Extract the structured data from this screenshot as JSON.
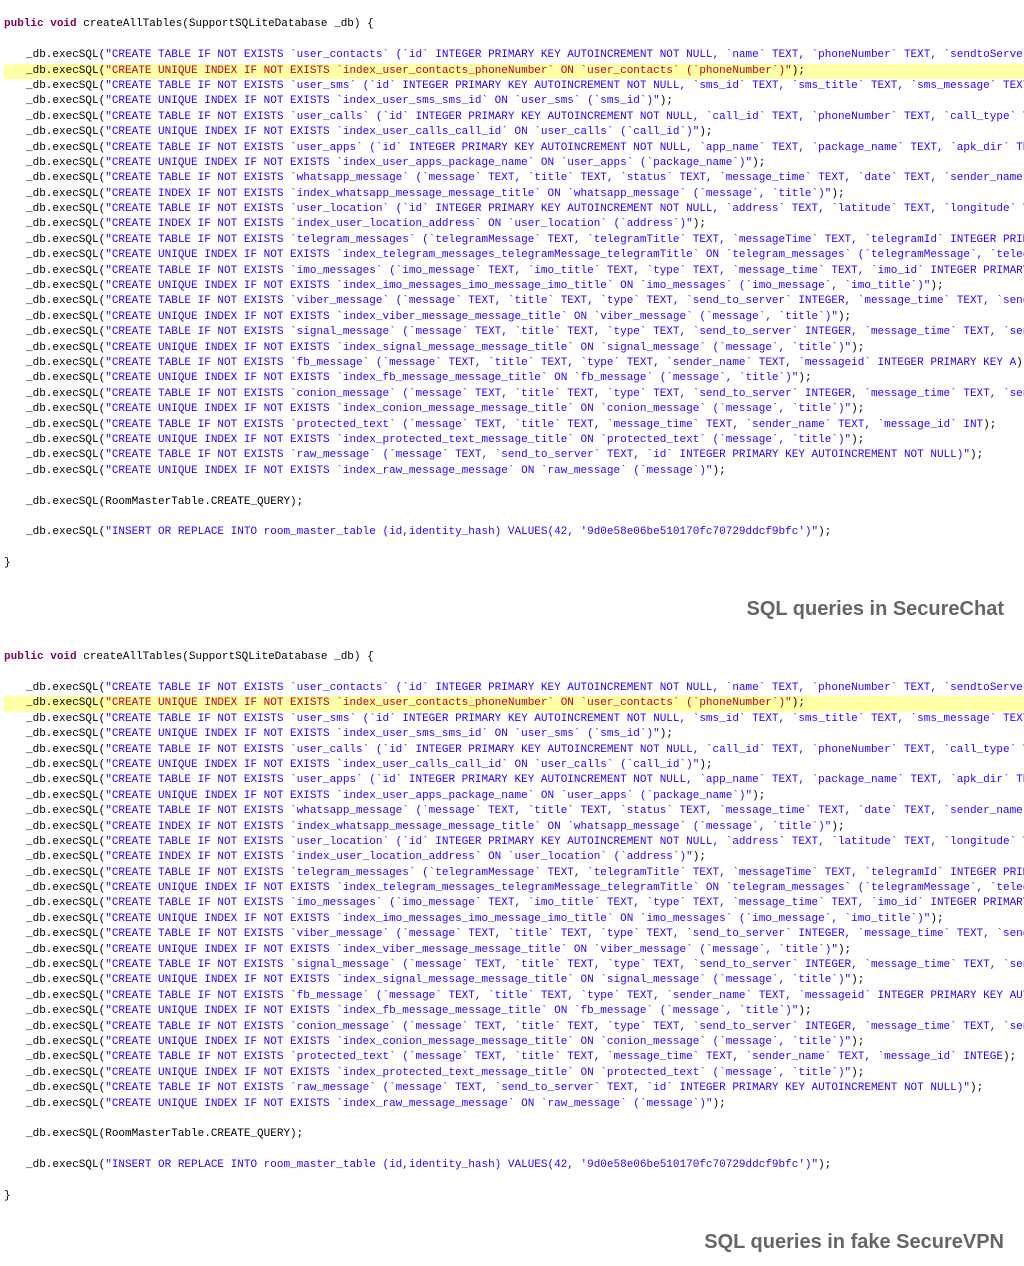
{
  "caption_top": "SQL queries in SecureChat",
  "caption_bottom": "SQL queries in fake SecureVPN",
  "sig_kw1": "public",
  "sig_kw2": "void",
  "sig_method": "createAllTables",
  "sig_param": "(SupportSQLiteDatabase _db) {",
  "call_prefix": "_db.execSQL(",
  "call_suffix": ");",
  "hl_a": "\"CREATE UNIQUE INDEX IF NOT EXISTS `",
  "hl_b": "index_user_contacts_phoneNumber` ON `user_contacts` (`phoneNumber`)\"",
  "create_query": "_db.execSQL(RoomMasterTable.CREATE_QUERY);",
  "top_lines": [
    "\"CREATE TABLE IF NOT EXISTS `user_contacts` (`id` INTEGER PRIMARY KEY AUTOINCREMENT NOT NULL, `name` TEXT, `phoneNumber` TEXT, `sendtoServer` INTE",
    "",
    "\"CREATE TABLE IF NOT EXISTS `user_sms` (`id` INTEGER PRIMARY KEY AUTOINCREMENT NOT NULL, `sms_id` TEXT, `sms_title` TEXT, `sms_message` TEXT, `sms",
    "\"CREATE UNIQUE INDEX IF NOT EXISTS `index_user_sms_sms_id` ON `user_sms` (`sms_id`)\"",
    "\"CREATE TABLE IF NOT EXISTS `user_calls` (`id` INTEGER PRIMARY KEY AUTOINCREMENT NOT NULL, `call_id` TEXT, `phoneNumber` TEXT, `call_type` TEXT, `",
    "\"CREATE UNIQUE INDEX IF NOT EXISTS `index_user_calls_call_id` ON `user_calls` (`call_id`)\"",
    "\"CREATE TABLE IF NOT EXISTS `user_apps` (`id` INTEGER PRIMARY KEY AUTOINCREMENT NOT NULL, `app_name` TEXT, `package_name` TEXT, `apk_dir` TEXT, `i",
    "\"CREATE UNIQUE INDEX IF NOT EXISTS `index_user_apps_package_name` ON `user_apps` (`package_name`)\"",
    "\"CREATE TABLE IF NOT EXISTS `whatsapp_message` (`message` TEXT, `title` TEXT, `status` TEXT, `message_time` TEXT, `date` TEXT, `sender_name` TEXT",
    "\"CREATE INDEX IF NOT EXISTS `index_whatsapp_message_message_title` ON `whatsapp_message` (`message`, `title`)\"",
    "\"CREATE TABLE IF NOT EXISTS `user_location` (`id` INTEGER PRIMARY KEY AUTOINCREMENT NOT NULL, `address` TEXT, `latitude` TEXT, `longitude` TEXT, `",
    "\"CREATE INDEX IF NOT EXISTS `index_user_location_address` ON `user_location` (`address`)\"",
    "\"CREATE TABLE IF NOT EXISTS `telegram_messages` (`telegramMessage` TEXT, `telegramTitle` TEXT, `messageTime` TEXT, `telegramId` INTEGER PRIMARY KE",
    "\"CREATE UNIQUE INDEX IF NOT EXISTS `index_telegram_messages_telegramMessage_telegramTitle` ON `telegram_messages` (`telegramMessage`, `telegramTit",
    "\"CREATE TABLE IF NOT EXISTS `imo_messages` (`imo_message` TEXT, `imo_title` TEXT, `type` TEXT, `message_time` TEXT, `imo_id` INTEGER PRIMARY KEY A",
    "\"CREATE UNIQUE INDEX IF NOT EXISTS `index_imo_messages_imo_message_imo_title` ON `imo_messages` (`imo_message`, `imo_title`)\"",
    "\"CREATE TABLE IF NOT EXISTS `viber_message` (`message` TEXT, `title` TEXT, `type` TEXT, `send_to_server` INTEGER, `message_time` TEXT, `sender_nam",
    "\"CREATE UNIQUE INDEX IF NOT EXISTS `index_viber_message_message_title` ON `viber_message` (`message`, `title`)\"",
    "\"CREATE TABLE IF NOT EXISTS `signal_message` (`message` TEXT, `title` TEXT, `type` TEXT, `send_to_server` INTEGER, `message_time` TEXT, `sender_na",
    "\"CREATE UNIQUE INDEX IF NOT EXISTS `index_signal_message_message_title` ON `signal_message` (`message`, `title`)\"",
    "\"CREATE TABLE IF NOT EXISTS `fb_message` (`message` TEXT, `title` TEXT, `type` TEXT, `sender_name` TEXT, `messageid` INTEGER PRIMARY KEY A",
    "\"CREATE UNIQUE INDEX IF NOT EXISTS `index_fb_message_message_title` ON `fb_message` (`message`, `title`)\"",
    "\"CREATE TABLE IF NOT EXISTS `conion_message` (`message` TEXT, `title` TEXT, `type` TEXT, `send_to_server` INTEGER, `message_time` TEXT, `sender_na",
    "\"CREATE UNIQUE INDEX IF NOT EXISTS `index_conion_message_message_title` ON `conion_message` (`message`, `title`)\"",
    "\"CREATE TABLE IF NOT EXISTS `protected_text` (`message` TEXT, `title` TEXT, `message_time` TEXT, `sender_name` TEXT, `message_id` INT",
    "\"CREATE UNIQUE INDEX IF NOT EXISTS `index_protected_text_message_title` ON `protected_text` (`message`, `title`)\"",
    "\"CREATE TABLE IF NOT EXISTS `raw_message` (`message` TEXT, `send_to_server` TEXT, `id` INTEGER PRIMARY KEY AUTOINCREMENT NOT NULL)\"",
    "\"CREATE UNIQUE INDEX IF NOT EXISTS `index_raw_message_message` ON `raw_message` (`message`)\""
  ],
  "top_insert": "\"INSERT OR REPLACE INTO room_master_table (id,identity_hash) VALUES(42, '9d0e58e06be510170fc70729ddcf9bfc')\"",
  "bottom_lines": [
    "\"CREATE TABLE IF NOT EXISTS `user_contacts` (`id` INTEGER PRIMARY KEY AUTOINCREMENT NOT NULL, `name` TEXT, `phoneNumber` TEXT, `sendtoServer` INTEGER",
    "",
    "\"CREATE TABLE IF NOT EXISTS `user_sms` (`id` INTEGER PRIMARY KEY AUTOINCREMENT NOT NULL, `sms_id` TEXT, `sms_title` TEXT, `sms_message` TEXT, `sms_ti",
    "\"CREATE UNIQUE INDEX IF NOT EXISTS `index_user_sms_sms_id` ON `user_sms` (`sms_id`)\"",
    "\"CREATE TABLE IF NOT EXISTS `user_calls` (`id` INTEGER PRIMARY KEY AUTOINCREMENT NOT NULL, `call_id` TEXT, `phoneNumber` TEXT, `call_type` TEXT, `cal",
    "\"CREATE UNIQUE INDEX IF NOT EXISTS `index_user_calls_call_id` ON `user_calls` (`call_id`)\"",
    "\"CREATE TABLE IF NOT EXISTS `user_apps` (`id` INTEGER PRIMARY KEY AUTOINCREMENT NOT NULL, `app_name` TEXT, `package_name` TEXT, `apk_dir` TEXT, `icor",
    "\"CREATE UNIQUE INDEX IF NOT EXISTS `index_user_apps_package_name` ON `user_apps` (`package_name`)\"",
    "\"CREATE TABLE IF NOT EXISTS `whatsapp_message` (`message` TEXT, `title` TEXT, `status` TEXT, `message_time` TEXT, `date` TEXT, `sender_name` TEXT, `m",
    "\"CREATE INDEX IF NOT EXISTS `index_whatsapp_message_message_title` ON `whatsapp_message` (`message`, `title`)\"",
    "\"CREATE TABLE IF NOT EXISTS `user_location` (`id` INTEGER PRIMARY KEY AUTOINCREMENT NOT NULL, `address` TEXT, `latitude` TEXT, `longitude` TEXT, `loc",
    "\"CREATE INDEX IF NOT EXISTS `index_user_location_address` ON `user_location` (`address`)\"",
    "\"CREATE TABLE IF NOT EXISTS `telegram_messages` (`telegramMessage` TEXT, `telegramTitle` TEXT, `messageTime` TEXT, `telegramId` INTEGER PRIMARY KEY A",
    "\"CREATE UNIQUE INDEX IF NOT EXISTS `index_telegram_messages_telegramMessage_telegramTitle` ON `telegram_messages` (`telegramMessage`, `telegramTitle",
    "\"CREATE TABLE IF NOT EXISTS `imo_messages` (`imo_message` TEXT, `imo_title` TEXT, `type` TEXT, `message_time` TEXT, `imo_id` INTEGER PRIMARY KEY AUTO",
    "\"CREATE UNIQUE INDEX IF NOT EXISTS `index_imo_messages_imo_message_imo_title` ON `imo_messages` (`imo_message`, `imo_title`)\"",
    "\"CREATE TABLE IF NOT EXISTS `viber_message` (`message` TEXT, `title` TEXT, `type` TEXT, `send_to_server` INTEGER, `message_time` TEXT, `sender_name`",
    "\"CREATE UNIQUE INDEX IF NOT EXISTS `index_viber_message_message_title` ON `viber_message` (`message`, `title`)\"",
    "\"CREATE TABLE IF NOT EXISTS `signal_message` (`message` TEXT, `title` TEXT, `type` TEXT, `send_to_server` INTEGER, `message_time` TEXT, `sender_name`",
    "\"CREATE UNIQUE INDEX IF NOT EXISTS `index_signal_message_message_title` ON `signal_message` (`message`, `title`)\"",
    "\"CREATE TABLE IF NOT EXISTS `fb_message` (`message` TEXT, `title` TEXT, `type` TEXT, `sender_name` TEXT, `messageid` INTEGER PRIMARY KEY AUTO",
    "\"CREATE UNIQUE INDEX IF NOT EXISTS `index_fb_message_message_title` ON `fb_message` (`message`, `title`)\"",
    "\"CREATE TABLE IF NOT EXISTS `conion_message` (`message` TEXT, `title` TEXT, `type` TEXT, `send_to_server` INTEGER, `message_time` TEXT, `sender_name`",
    "\"CREATE UNIQUE INDEX IF NOT EXISTS `index_conion_message_message_title` ON `conion_message` (`message`, `title`)\"",
    "\"CREATE TABLE IF NOT EXISTS `protected_text` (`message` TEXT, `title` TEXT, `message_time` TEXT, `sender_name` TEXT, `message_id` INTEGE",
    "\"CREATE UNIQUE INDEX IF NOT EXISTS `index_protected_text_message_title` ON `protected_text` (`message`, `title`)\"",
    "\"CREATE TABLE IF NOT EXISTS `raw_message` (`message` TEXT, `send_to_server` TEXT, `id` INTEGER PRIMARY KEY AUTOINCREMENT NOT NULL)\"",
    "\"CREATE UNIQUE INDEX IF NOT EXISTS `index_raw_message_message` ON `raw_message` (`message`)\""
  ],
  "bottom_insert": "\"INSERT OR REPLACE INTO room_master_table (id,identity_hash) VALUES(42, '9d0e58e06be510170fc70729ddcf9bfc')\""
}
